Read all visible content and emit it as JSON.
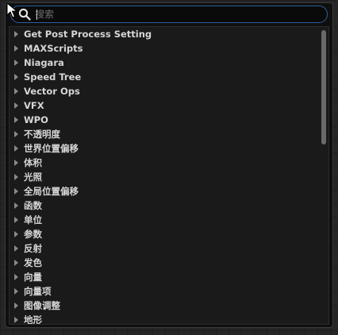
{
  "search": {
    "placeholder": "搜索",
    "value": ""
  },
  "categories": [
    {
      "label": "Get Post Process Setting"
    },
    {
      "label": "MAXScripts"
    },
    {
      "label": "Niagara"
    },
    {
      "label": "Speed Tree"
    },
    {
      "label": "Vector Ops"
    },
    {
      "label": "VFX"
    },
    {
      "label": "WPO"
    },
    {
      "label": "不透明度"
    },
    {
      "label": "世界位置偏移"
    },
    {
      "label": "体积"
    },
    {
      "label": "光照"
    },
    {
      "label": "全局位置偏移"
    },
    {
      "label": "函数"
    },
    {
      "label": "单位"
    },
    {
      "label": "参数"
    },
    {
      "label": "反射"
    },
    {
      "label": "发色"
    },
    {
      "label": "向量"
    },
    {
      "label": "向量项"
    },
    {
      "label": "图像调整"
    },
    {
      "label": "地形"
    }
  ],
  "colors": {
    "accent": "#2f5f9e",
    "background": "#262626",
    "list_bg": "#1a1a1a",
    "text": "#d6d6d6"
  },
  "icons": {
    "search": "search-icon",
    "expand": "triangle-right-icon",
    "pointer": "mouse-cursor-icon"
  }
}
